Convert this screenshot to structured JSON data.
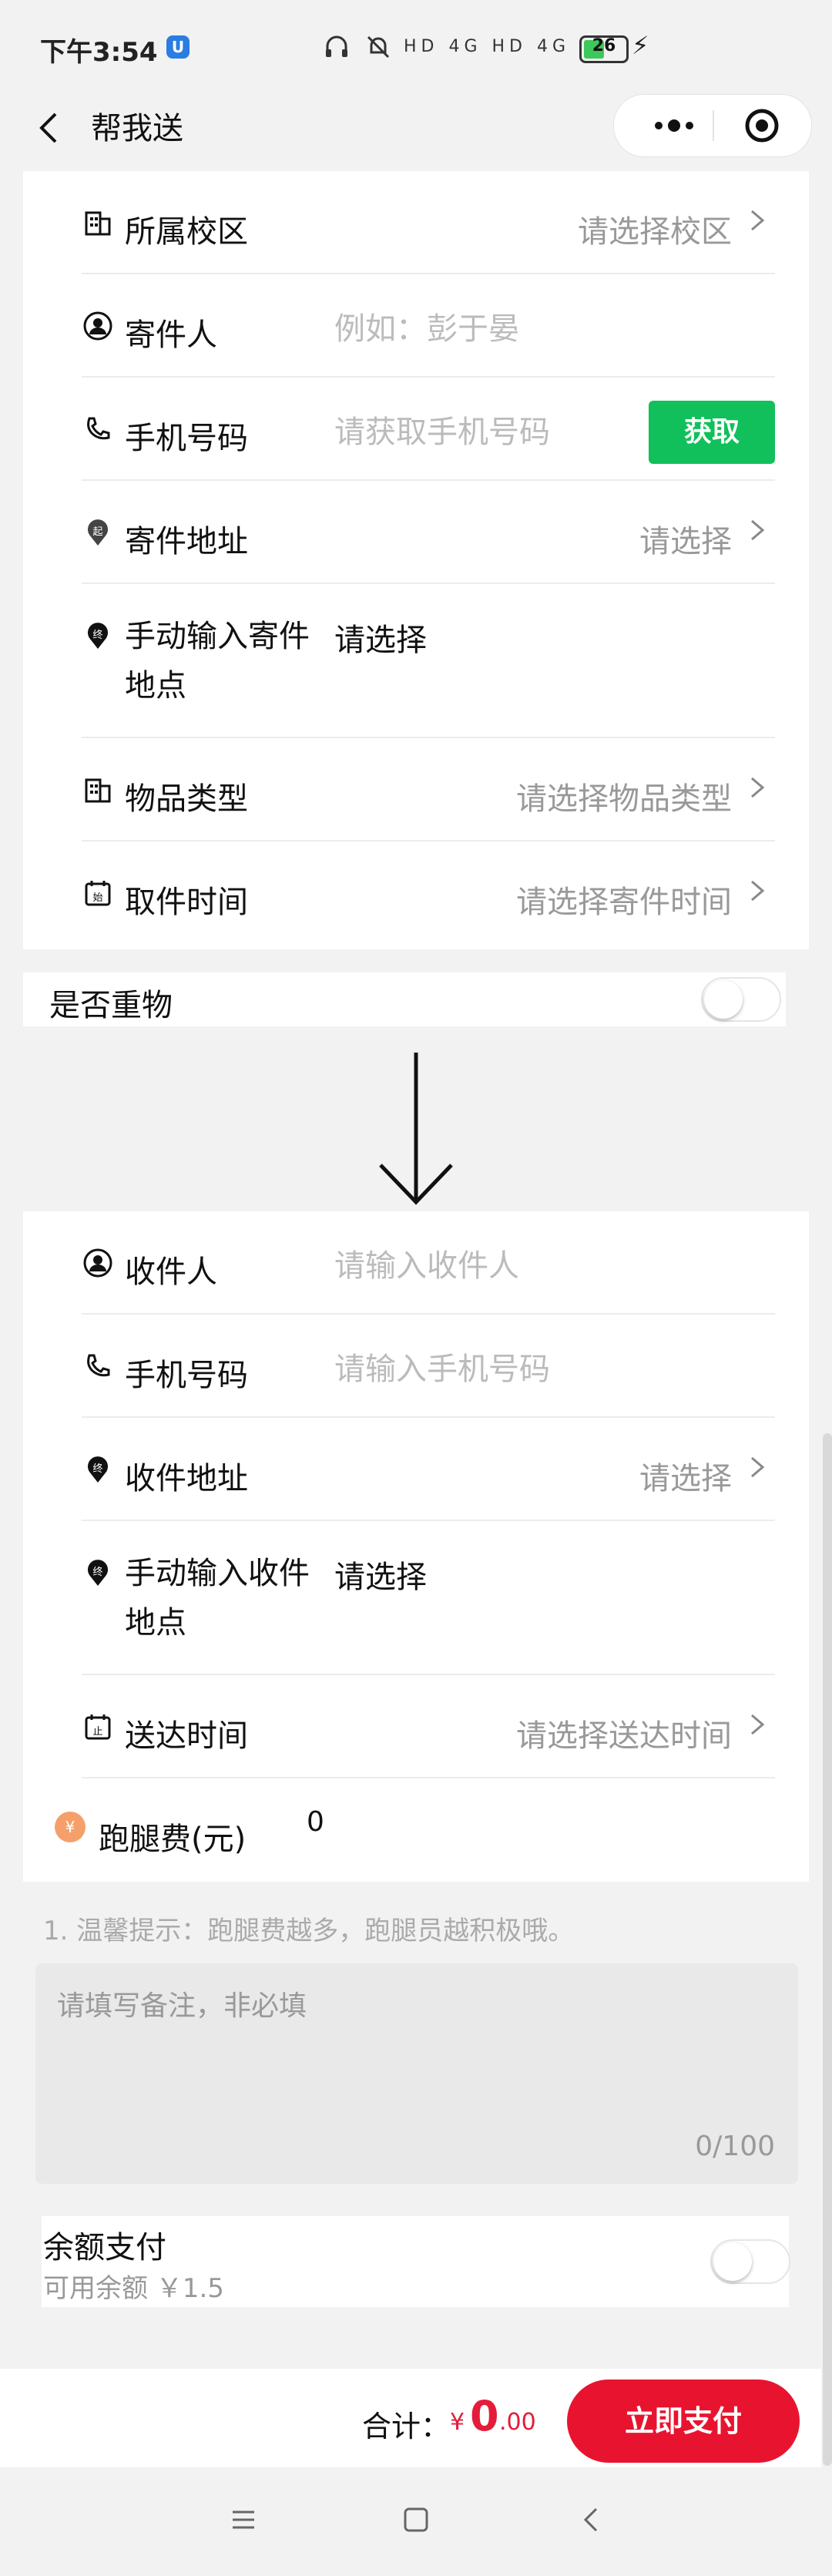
{
  "status_bar": {
    "time": "下午3:54",
    "app_badge": "U",
    "signal_text": "HD 4G HD 4G",
    "battery": "26"
  },
  "nav": {
    "title": "帮我送"
  },
  "sender": {
    "campus": {
      "label": "所属校区",
      "value": "请选择校区"
    },
    "name": {
      "label": "寄件人",
      "placeholder": "例如：彭于晏"
    },
    "phone": {
      "label": "手机号码",
      "placeholder": "请获取手机号码",
      "button": "获取"
    },
    "address": {
      "label": "寄件地址",
      "value": "请选择",
      "icon_text": "起"
    },
    "manual": {
      "label": "手动输入寄件地点",
      "value": "请选择",
      "icon_text": "终"
    },
    "item_type": {
      "label": "物品类型",
      "value": "请选择物品类型"
    },
    "pickup_time": {
      "label": "取件时间",
      "value": "请选择寄件时间",
      "icon_text": "始"
    }
  },
  "heavy": {
    "label": "是否重物",
    "on": false
  },
  "receiver": {
    "name": {
      "label": "收件人",
      "placeholder": "请输入收件人"
    },
    "phone": {
      "label": "手机号码",
      "placeholder": "请输入手机号码"
    },
    "address": {
      "label": "收件地址",
      "value": "请选择",
      "icon_text": "终"
    },
    "manual": {
      "label": "手动输入收件地点",
      "value": "请选择",
      "icon_text": "终"
    },
    "delivery_time": {
      "label": "送达时间",
      "value": "请选择送达时间",
      "icon_text": "止"
    },
    "fee": {
      "label": "跑腿费(元)",
      "value": "0",
      "icon_text": "¥"
    }
  },
  "hint": "1. 温馨提示：跑腿费越多，跑腿员越积极哦。",
  "remark": {
    "placeholder": "请填写备注，非必填",
    "count": "0/100"
  },
  "balance": {
    "label": "余额支付",
    "available": "可用余额 ￥1.5",
    "on": false
  },
  "footer": {
    "total_label": "合计：",
    "currency": "¥",
    "total_int": "0",
    "total_dec": ".00",
    "pay_button": "立即支付"
  },
  "colors": {
    "accent_green": "#11c05a",
    "accent_red": "#e8142f",
    "fee_icon": "#f5a06a"
  }
}
